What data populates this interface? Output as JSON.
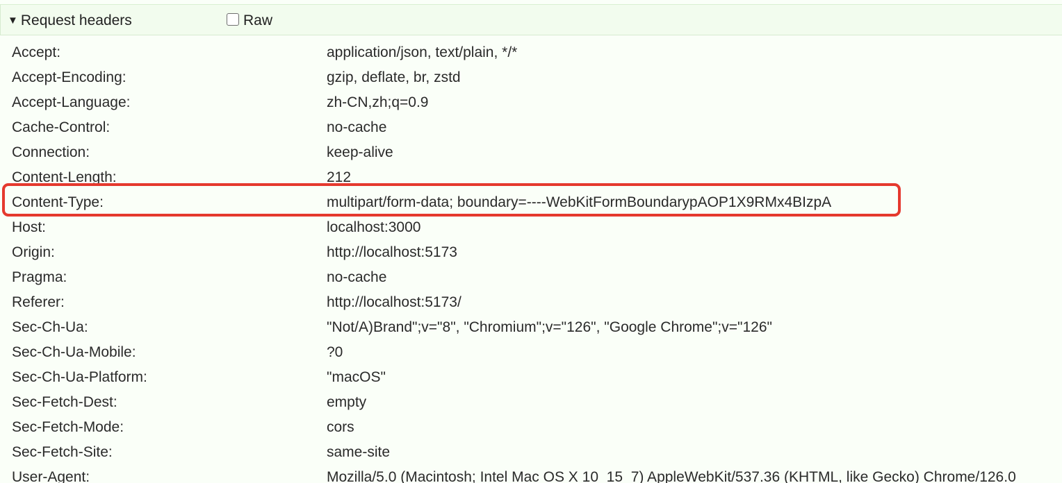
{
  "section": {
    "title": "Request headers",
    "collapse_icon": "triangle-down-icon",
    "raw_label": "Raw",
    "raw_checked": false
  },
  "headers": [
    {
      "name": "Accept:",
      "value": "application/json, text/plain, */*"
    },
    {
      "name": "Accept-Encoding:",
      "value": "gzip, deflate, br, zstd"
    },
    {
      "name": "Accept-Language:",
      "value": "zh-CN,zh;q=0.9"
    },
    {
      "name": "Cache-Control:",
      "value": "no-cache"
    },
    {
      "name": "Connection:",
      "value": "keep-alive"
    },
    {
      "name": "Content-Length:",
      "value": "212"
    },
    {
      "name": "Content-Type:",
      "value": "multipart/form-data; boundary=----WebKitFormBoundarypAOP1X9RMx4BIzpA"
    },
    {
      "name": "Host:",
      "value": "localhost:3000"
    },
    {
      "name": "Origin:",
      "value": "http://localhost:5173"
    },
    {
      "name": "Pragma:",
      "value": "no-cache"
    },
    {
      "name": "Referer:",
      "value": "http://localhost:5173/"
    },
    {
      "name": "Sec-Ch-Ua:",
      "value": "\"Not/A)Brand\";v=\"8\", \"Chromium\";v=\"126\", \"Google Chrome\";v=\"126\""
    },
    {
      "name": "Sec-Ch-Ua-Mobile:",
      "value": "?0"
    },
    {
      "name": "Sec-Ch-Ua-Platform:",
      "value": "\"macOS\""
    },
    {
      "name": "Sec-Fetch-Dest:",
      "value": "empty"
    },
    {
      "name": "Sec-Fetch-Mode:",
      "value": "cors"
    },
    {
      "name": "Sec-Fetch-Site:",
      "value": "same-site"
    },
    {
      "name": "User-Agent:",
      "value": "Mozilla/5.0 (Macintosh; Intel Mac OS X 10_15_7) AppleWebKit/537.36 (KHTML, like Gecko) Chrome/126.0"
    }
  ],
  "highlighted_header": "Content-Type:",
  "colors": {
    "highlight_border": "#e5392e",
    "header_bar": "#f2fcee"
  }
}
